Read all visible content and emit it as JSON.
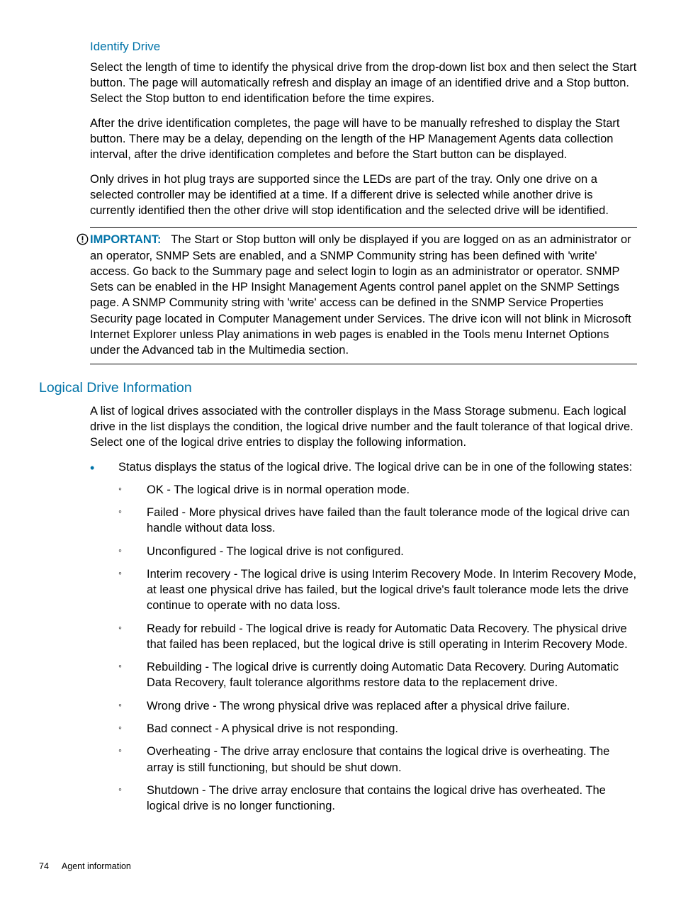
{
  "section1": {
    "heading": "Identify Drive",
    "para1": "Select the length of time to identify the physical drive from the drop-down list box and then select the Start button. The page will automatically refresh and display an image of an identified drive and a Stop button. Select the Stop button to end identification before the time expires.",
    "para2": "After the drive identification completes, the page will have to be manually refreshed to display the Start button. There may be a delay, depending on the length of the HP Management Agents data collection interval, after the drive identification completes and before the Start button can be displayed.",
    "para3": "Only drives in hot plug trays are supported since the LEDs are part of the tray. Only one drive on a selected controller may be identified at a time. If a different drive is selected while another drive is currently identified then the other drive will stop identification and the selected drive will be identified."
  },
  "important": {
    "label": "IMPORTANT:",
    "text": "The Start or Stop button will only be displayed if you are logged on as an administrator or an operator, SNMP Sets are enabled, and a SNMP Community string has been defined with 'write' access. Go back to the Summary page and select login to login as an administrator or operator. SNMP Sets can be enabled in the HP Insight Management Agents control panel applet on the SNMP Settings page. A SNMP Community string with 'write' access can be defined in the SNMP Service Properties Security page located in Computer Management under Services. The drive icon will not blink in Microsoft Internet Explorer unless Play animations in web pages is enabled in the Tools menu Internet Options under the Advanced tab in the Multimedia section."
  },
  "section2": {
    "heading": "Logical Drive Information",
    "intro": "A list of logical drives associated with the controller displays in the Mass Storage submenu. Each logical drive in the list displays the condition, the logical drive number and the fault tolerance of that logical drive. Select one of the logical drive entries to display the following information.",
    "bullet1": "Status displays the status of the logical drive. The logical drive can be in one of the following states:",
    "states": [
      "OK - The logical drive is in normal operation mode.",
      "Failed - More physical drives have failed than the fault tolerance mode of the logical drive can handle without data loss.",
      "Unconfigured - The logical drive is not configured.",
      "Interim recovery - The logical drive is using Interim Recovery Mode. In Interim Recovery Mode, at least one physical drive has failed, but the logical drive's fault tolerance mode lets the drive continue to operate with no data loss.",
      "Ready for rebuild - The logical drive is ready for Automatic Data Recovery. The physical drive that failed has been replaced, but the logical drive is still operating in Interim Recovery Mode.",
      "Rebuilding - The logical drive is currently doing Automatic Data Recovery. During Automatic Data Recovery, fault tolerance algorithms restore data to the replacement drive.",
      "Wrong drive - The wrong physical drive was replaced after a physical drive failure.",
      "Bad connect - A physical drive is not responding.",
      "Overheating - The drive array enclosure that contains the logical drive is overheating. The array is still functioning, but should be shut down.",
      "Shutdown - The drive array enclosure that contains the logical drive has overheated. The logical drive is no longer functioning."
    ]
  },
  "footer": {
    "page": "74",
    "section": "Agent information"
  }
}
